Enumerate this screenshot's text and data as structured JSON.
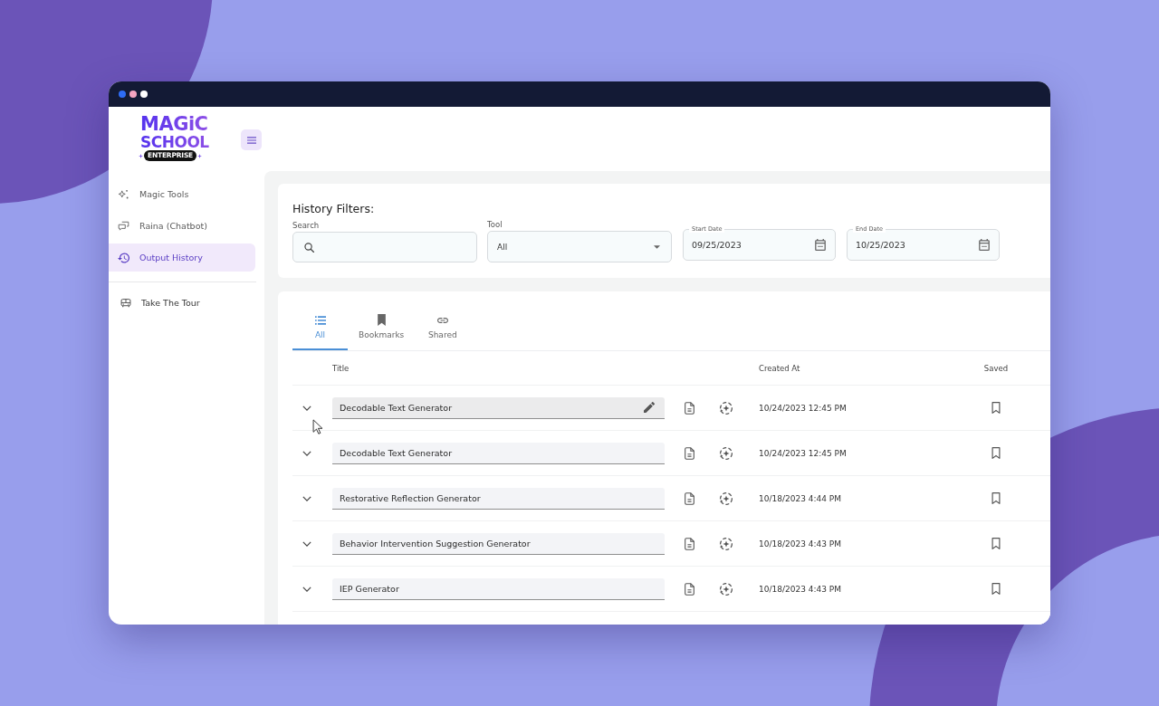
{
  "window": {
    "controls": [
      {
        "color": "#2e6cf5"
      },
      {
        "color": "#f5a4c1"
      },
      {
        "color": "#ffffff"
      }
    ]
  },
  "logo": {
    "lines": [
      "MAGiC",
      "SCHOOL"
    ],
    "badge": "ENTERPRISE"
  },
  "sidebar": {
    "items": [
      {
        "label": "Magic Tools",
        "selected": false
      },
      {
        "label": "Raina (Chatbot)",
        "selected": false
      },
      {
        "label": "Output History",
        "selected": true
      }
    ],
    "footer_items": [
      {
        "label": "Take The Tour",
        "selected": false
      }
    ]
  },
  "filters": {
    "title": "History Filters:",
    "search": {
      "label": "Search"
    },
    "tool": {
      "label": "Tool",
      "value": "All"
    },
    "dates": [
      {
        "label": "Start Date",
        "value": "09/25/2023"
      },
      {
        "label": "End Date",
        "value": "10/25/2023"
      }
    ]
  },
  "tabs": [
    {
      "label": "All",
      "selected": true
    },
    {
      "label": "Bookmarks",
      "selected": false
    },
    {
      "label": "Shared",
      "selected": false
    }
  ],
  "table": {
    "columns": [
      "Title",
      "Created At",
      "Saved"
    ],
    "rows": [
      {
        "title": "Decodable Text Generator",
        "created_at": "10/24/2023 12:45 PM",
        "hovered": true,
        "saved": false
      },
      {
        "title": "Decodable Text Generator",
        "created_at": "10/24/2023 12:45 PM",
        "hovered": false,
        "saved": false
      },
      {
        "title": "Restorative Reflection Generator",
        "created_at": "10/18/2023 4:44 PM",
        "hovered": false,
        "saved": false
      },
      {
        "title": "Behavior Intervention Suggestion Generator",
        "created_at": "10/18/2023 4:43 PM",
        "hovered": false,
        "saved": false
      },
      {
        "title": "IEP Generator",
        "created_at": "10/18/2023 4:43 PM",
        "hovered": false,
        "saved": false
      }
    ]
  }
}
